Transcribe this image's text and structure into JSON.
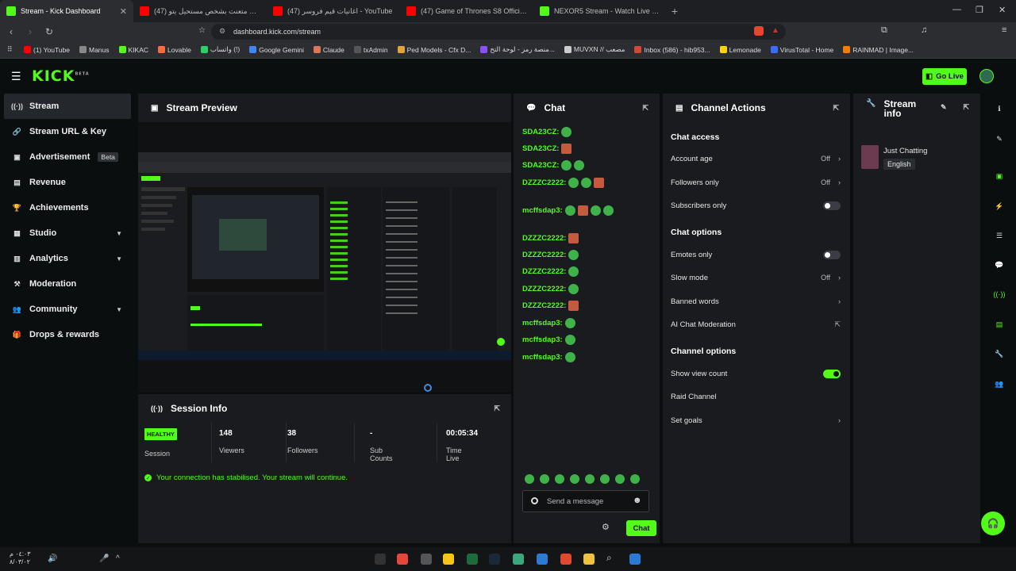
{
  "browser": {
    "tabs": [
      {
        "title": "Stream - Kick Dashboard",
        "color": "#53fc18",
        "active": true
      },
      {
        "title": "(47) فاجأت متعنت بشخص مستحيل يتو...",
        "color": "#ff0000",
        "active": false
      },
      {
        "title": "(47) اغانيات قيم فروسر - YouTube",
        "color": "#ff0000",
        "active": false
      },
      {
        "title": "(47) Game of Thrones S8 Official Sou...",
        "color": "#ff0000",
        "active": false
      },
      {
        "title": "NEXOR5 Stream - Watch Live on Kick",
        "color": "#53fc18",
        "active": false
      }
    ],
    "url": "dashboard.kick.com/stream",
    "bookmarks": [
      "(1) YouTube",
      "Manus",
      "KIKAC",
      "Lovable",
      "واتساب (!)",
      "Google Gemini",
      "Claude",
      "txAdmin",
      "Ped Models - Cfx D...",
      "منصة رمز - لوحة التح...",
      "MUVXN // مصعب",
      "Inbox (586) - hib953...",
      "Lemonade",
      "VirusTotal - Home",
      "RAINMAD | Image..."
    ]
  },
  "header": {
    "logo": "KICK",
    "logo_badge": "BETA",
    "go_live": "Go Live"
  },
  "sidebar": {
    "items": [
      {
        "label": "Stream",
        "icon": "broadcast-icon",
        "glyph": "((·))"
      },
      {
        "label": "Stream URL & Key",
        "icon": "link-icon",
        "glyph": "🔗"
      },
      {
        "label": "Advertisement",
        "icon": "ad-icon",
        "glyph": "▣",
        "badge": "Beta"
      },
      {
        "label": "Revenue",
        "icon": "chart-icon",
        "glyph": "▤"
      },
      {
        "label": "Achievements",
        "icon": "trophy-icon",
        "glyph": "🏆"
      },
      {
        "label": "Studio",
        "icon": "studio-icon",
        "glyph": "▦",
        "chevron": true
      },
      {
        "label": "Analytics",
        "icon": "analytics-icon",
        "glyph": "▥",
        "chevron": true
      },
      {
        "label": "Moderation",
        "icon": "hammer-icon",
        "glyph": "⚒"
      },
      {
        "label": "Community",
        "icon": "community-icon",
        "glyph": "👥",
        "chevron": true
      },
      {
        "label": "Drops & rewards",
        "icon": "gift-icon",
        "glyph": "🎁"
      }
    ]
  },
  "preview": {
    "title": "Stream Preview"
  },
  "session": {
    "title": "Session Info",
    "badge": "HEALTHY",
    "session_label": "Session",
    "stats": [
      {
        "value": "148",
        "label": "Viewers"
      },
      {
        "value": "38",
        "label": "Followers"
      },
      {
        "value": "-",
        "label": "Sub Counts"
      },
      {
        "value": "00:05:34",
        "label": "Time Live"
      }
    ],
    "message": "Your connection has stabilised. Your stream will continue."
  },
  "chat": {
    "title": "Chat",
    "messages": [
      {
        "user": "SDA23CZ:"
      },
      {
        "user": "SDA23CZ:"
      },
      {
        "user": "SDA23CZ:"
      },
      {
        "user": "DZZZC2222:"
      },
      {
        "user": "mcffsdap3:"
      },
      {
        "user": "DZZZC2222:"
      },
      {
        "user": "DZZZC2222:"
      },
      {
        "user": "DZZZC2222:"
      },
      {
        "user": "DZZZC2222:"
      },
      {
        "user": "DZZZC2222:"
      },
      {
        "user": "mcffsdap3:"
      },
      {
        "user": "mcffsdap3:"
      },
      {
        "user": "mcffsdap3:"
      }
    ],
    "placeholder": "Send a message",
    "send": "Chat"
  },
  "actions": {
    "title": "Channel Actions",
    "chat_access": "Chat access",
    "account_age": "Account age",
    "account_age_value": "Off",
    "followers_only": "Followers only",
    "followers_only_value": "Off",
    "subscribers_only": "Subscribers only",
    "chat_options": "Chat options",
    "emotes_only": "Emotes only",
    "slow_mode": "Slow mode",
    "slow_mode_value": "Off",
    "banned_words": "Banned words",
    "ai_moderation": "AI Chat Moderation",
    "channel_options": "Channel options",
    "show_view_count": "Show view count",
    "raid_channel": "Raid Channel",
    "set_goals": "Set goals"
  },
  "stream_info": {
    "title": "Stream info",
    "category": "Just Chatting",
    "language": "English"
  },
  "taskbar": {
    "time": "٠٤:٠٣ م",
    "date": "٨/٠٣/٠٢"
  },
  "colors": {
    "accent": "#53fc18",
    "bg": "#0b0e0f",
    "panel": "#191b1f"
  }
}
